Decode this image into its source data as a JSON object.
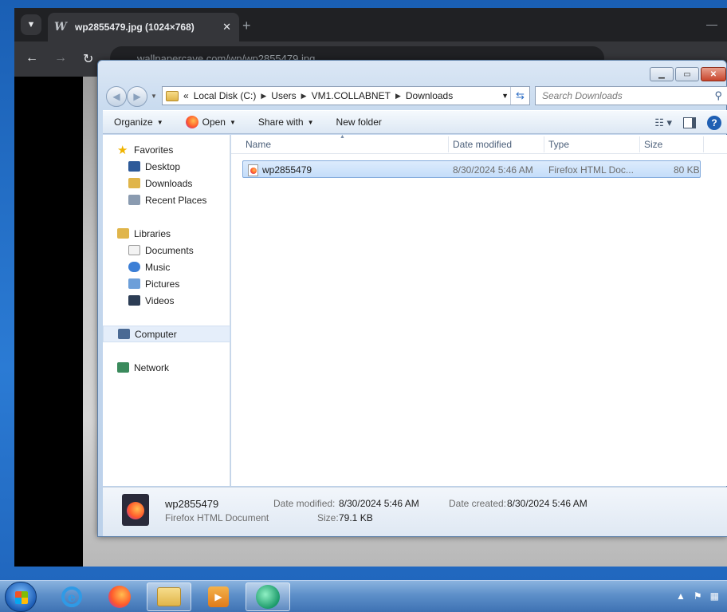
{
  "browser": {
    "tab_title": "wp2855479.jpg (1024×768)",
    "tab_menu_icon": "chevron-down-icon",
    "url": "wallpapercave.com/wp/wp2855479.jpg"
  },
  "explorer": {
    "breadcrumb": [
      "«",
      "Local Disk (C:)",
      "Users",
      "VM1.COLLABNET",
      "Downloads"
    ],
    "search_placeholder": "Search Downloads",
    "commands": {
      "organize": "Organize",
      "open": "Open",
      "share_with": "Share with",
      "new_folder": "New folder"
    },
    "nav": {
      "favorites": "Favorites",
      "desktop": "Desktop",
      "downloads": "Downloads",
      "recent_places": "Recent Places",
      "libraries": "Libraries",
      "documents": "Documents",
      "music": "Music",
      "pictures": "Pictures",
      "videos": "Videos",
      "computer": "Computer",
      "network": "Network"
    },
    "columns": {
      "name": "Name",
      "date_modified": "Date modified",
      "type": "Type",
      "size": "Size"
    },
    "files": [
      {
        "name": "wp2855479",
        "date_modified": "8/30/2024 5:46 AM",
        "type": "Firefox HTML Doc...",
        "size": "80 KB"
      }
    ],
    "details": {
      "name": "wp2855479",
      "type": "Firefox HTML Document",
      "date_modified_label": "Date modified:",
      "date_modified": "8/30/2024 5:46 AM",
      "date_created_label": "Date created:",
      "date_created": "8/30/2024 5:46 AM",
      "size_label": "Size:",
      "size": "79.1 KB"
    }
  },
  "colors": {
    "selection": "#c4ddfa",
    "taskbar": "#5d8fc9",
    "chrome_dark": "#202124"
  }
}
